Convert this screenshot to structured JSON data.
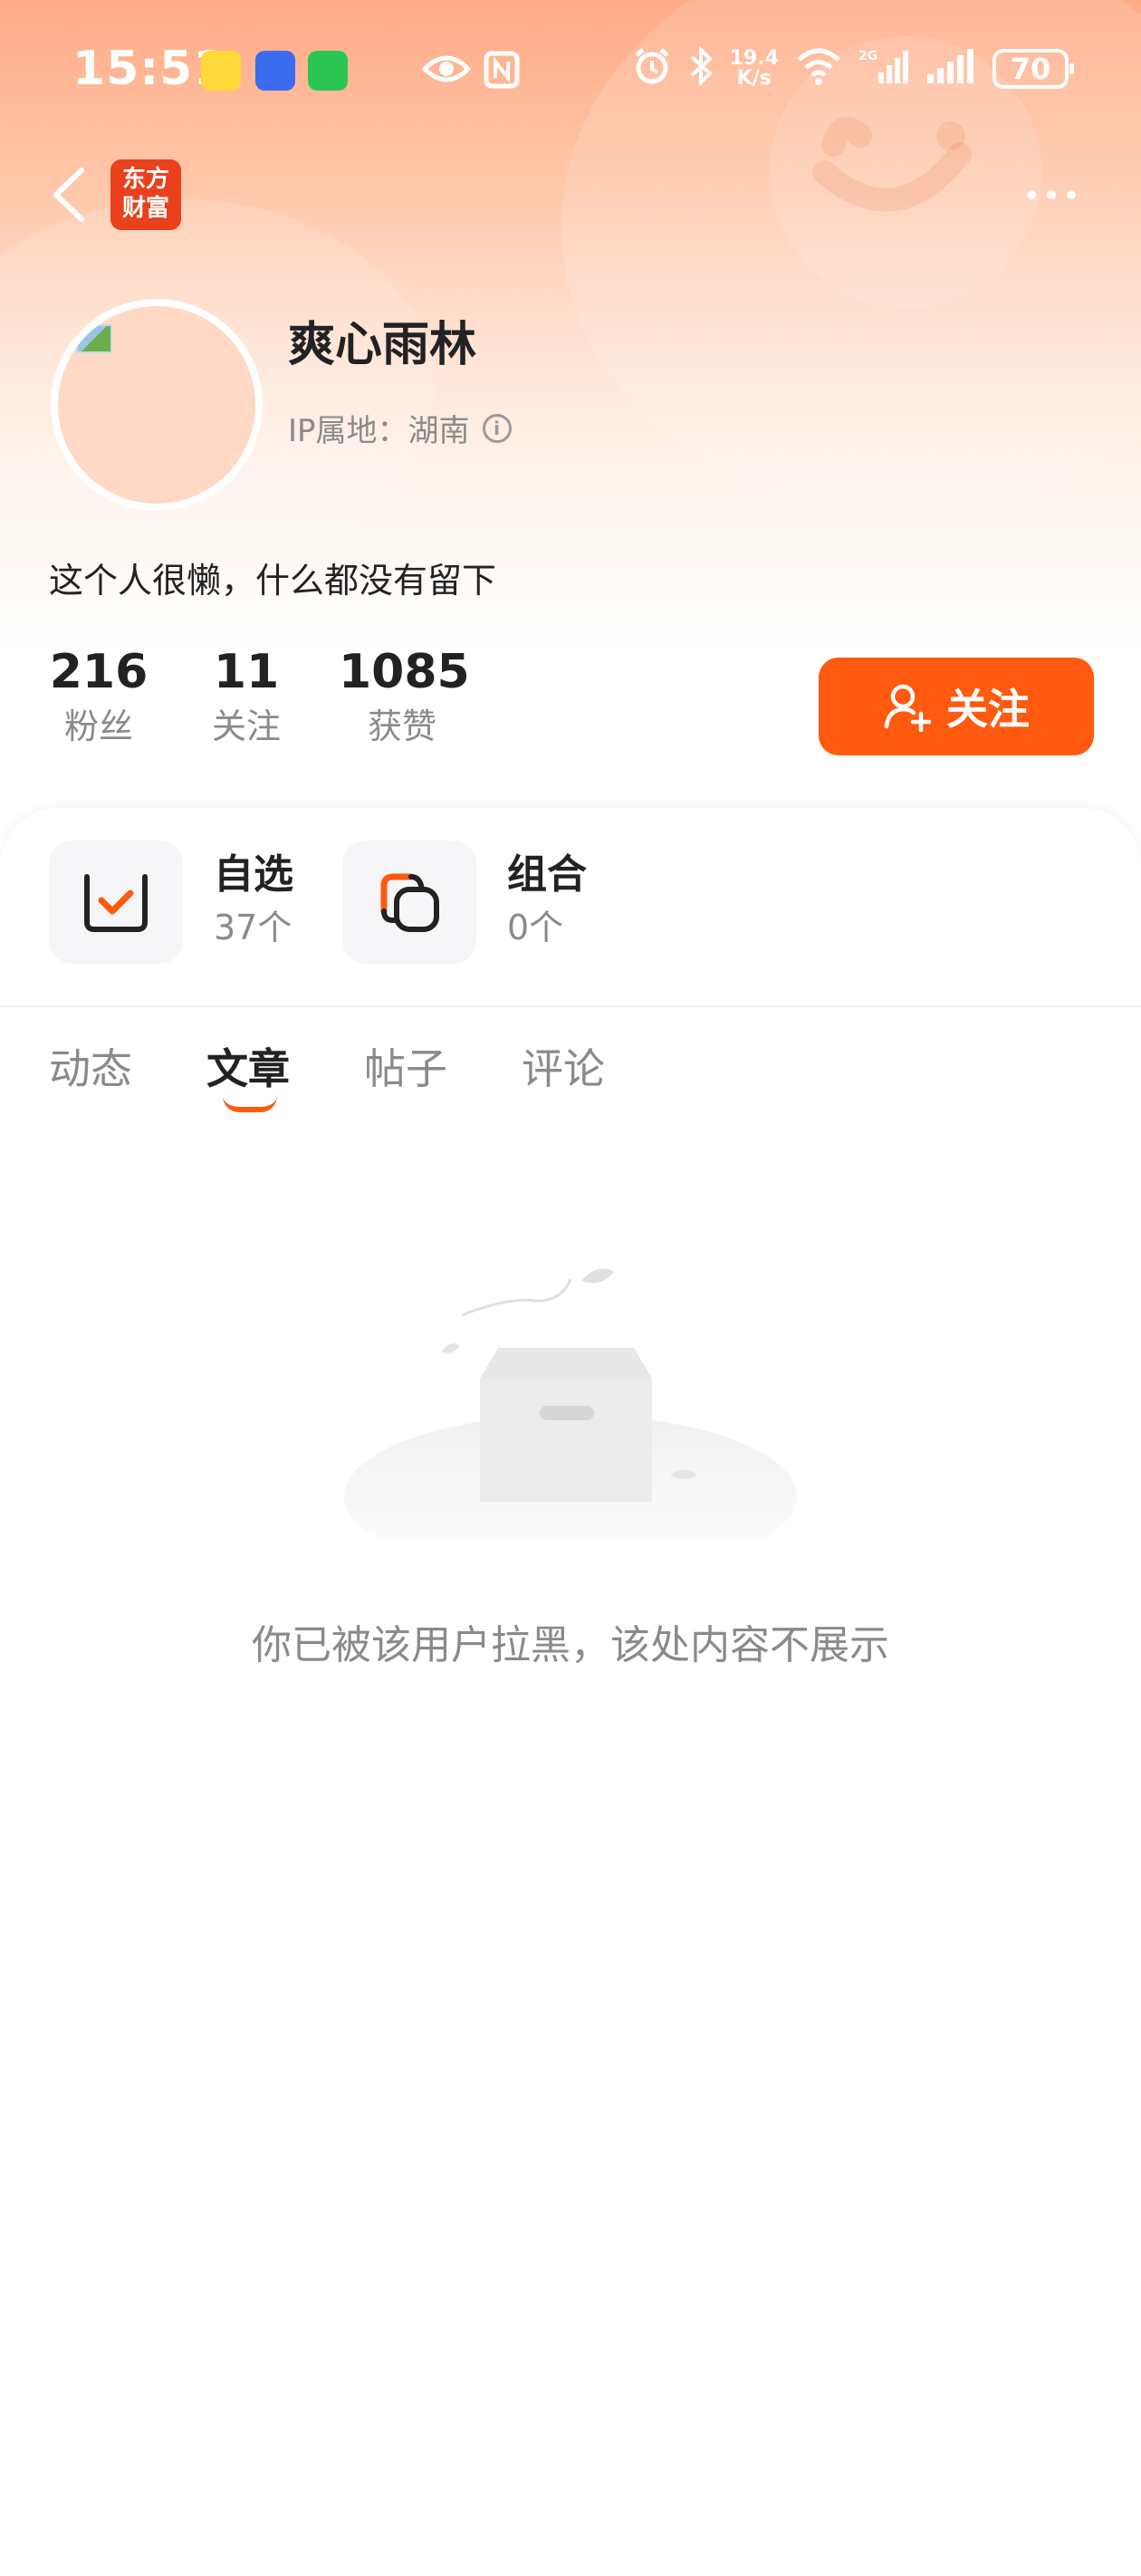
{
  "status_bar": {
    "time": "15:51",
    "net_speed_value": "19.4",
    "net_speed_unit": "K/s",
    "network_type": "2G",
    "battery": "70"
  },
  "header": {
    "logo_text_line1": "东方",
    "logo_text_line2": "财富"
  },
  "profile": {
    "username": "爽心雨林",
    "ip_location": "IP属地：湖南",
    "bio": "这个人很懒，什么都没有留下",
    "stats": [
      {
        "value": "216",
        "label": "粉丝"
      },
      {
        "value": "11",
        "label": "关注"
      },
      {
        "value": "1085",
        "label": "获赞"
      }
    ],
    "follow_label": "关注"
  },
  "shortcuts": [
    {
      "title": "自选",
      "count": "37个"
    },
    {
      "title": "组合",
      "count": "0个"
    }
  ],
  "tabs": [
    {
      "label": "动态",
      "active": false
    },
    {
      "label": "文章",
      "active": true
    },
    {
      "label": "帖子",
      "active": false
    },
    {
      "label": "评论",
      "active": false
    }
  ],
  "empty_state": {
    "message": "你已被该用户拉黑，该处内容不展示"
  },
  "colors": {
    "accent": "#ff5a0f",
    "logo_red": "#e8411c"
  }
}
